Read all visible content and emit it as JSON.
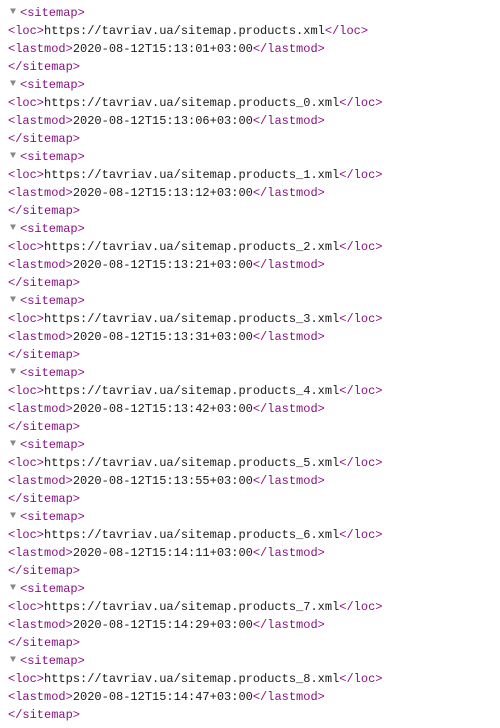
{
  "triangle": "▼",
  "tags": {
    "sitemap_open": "<sitemap>",
    "sitemap_close": "</sitemap>",
    "loc_open": "<loc>",
    "loc_close": "</loc>",
    "lastmod_open": "<lastmod>",
    "lastmod_close": "</lastmod>"
  },
  "entries": [
    {
      "loc": "https://tavriav.ua/sitemap.products.xml",
      "lastmod": "2020-08-12T15:13:01+03:00"
    },
    {
      "loc": "https://tavriav.ua/sitemap.products_0.xml",
      "lastmod": "2020-08-12T15:13:06+03:00"
    },
    {
      "loc": "https://tavriav.ua/sitemap.products_1.xml",
      "lastmod": "2020-08-12T15:13:12+03:00"
    },
    {
      "loc": "https://tavriav.ua/sitemap.products_2.xml",
      "lastmod": "2020-08-12T15:13:21+03:00"
    },
    {
      "loc": "https://tavriav.ua/sitemap.products_3.xml",
      "lastmod": "2020-08-12T15:13:31+03:00"
    },
    {
      "loc": "https://tavriav.ua/sitemap.products_4.xml",
      "lastmod": "2020-08-12T15:13:42+03:00"
    },
    {
      "loc": "https://tavriav.ua/sitemap.products_5.xml",
      "lastmod": "2020-08-12T15:13:55+03:00"
    },
    {
      "loc": "https://tavriav.ua/sitemap.products_6.xml",
      "lastmod": "2020-08-12T15:14:11+03:00"
    },
    {
      "loc": "https://tavriav.ua/sitemap.products_7.xml",
      "lastmod": "2020-08-12T15:14:29+03:00"
    },
    {
      "loc": "https://tavriav.ua/sitemap.products_8.xml",
      "lastmod": "2020-08-12T15:14:47+03:00"
    }
  ]
}
